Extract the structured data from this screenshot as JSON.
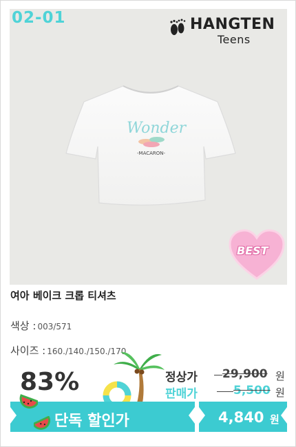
{
  "product": {
    "code": "02-01",
    "brand": {
      "main": "HANGTEN",
      "sub": "Teens"
    },
    "print_text": "Wonder",
    "print_subtext": "-MACARON-",
    "badge": "BEST",
    "title": "여아 베이크 크롭 티셔츠",
    "color": {
      "label": "색상 :",
      "value": "003/571"
    },
    "size": {
      "label": "사이즈 :",
      "value": "160./140./150./170"
    }
  },
  "pricing": {
    "discount_pct": "83%",
    "regular_label": "정상가",
    "regular_price": "29,900",
    "sale_label": "판매가",
    "sale_price": "5,500",
    "currency": "원",
    "banner_label": "단독 할인가",
    "final_price": "4,840",
    "final_currency": "원"
  },
  "colors": {
    "accent": "#3ccbd1",
    "code": "#4fd3d7",
    "badge_pink": "#f7b2d4"
  },
  "icons": [
    "watermelon-icon",
    "palm-tree-icon",
    "swim-ring-icon",
    "heart-badge-icon",
    "feet-logo-icon"
  ]
}
